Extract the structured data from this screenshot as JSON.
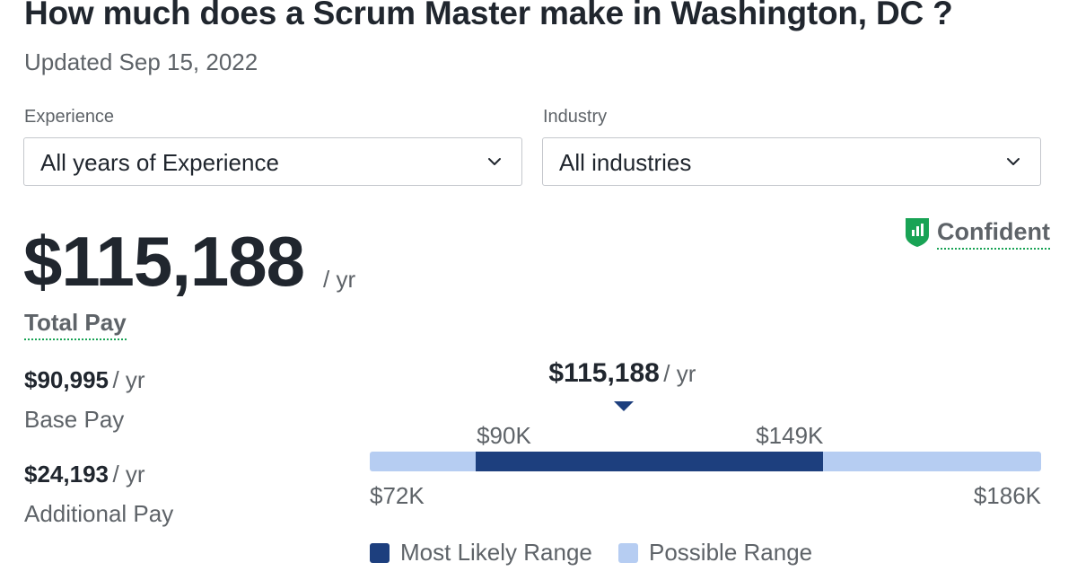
{
  "header": {
    "title": "How much does a Scrum Master make in Washington, DC ?",
    "updated": "Updated Sep 15, 2022"
  },
  "filters": {
    "experience": {
      "label": "Experience",
      "value": "All years of Experience"
    },
    "industry": {
      "label": "Industry",
      "value": "All industries"
    }
  },
  "salary": {
    "total_amount": "$115,188",
    "per_year": "/ yr",
    "total_label": "Total Pay",
    "confidence": "Confident",
    "base": {
      "amount": "$90,995",
      "per_year": "/ yr",
      "label": "Base Pay"
    },
    "additional": {
      "amount": "$24,193",
      "per_year": "/ yr",
      "label": "Additional Pay"
    }
  },
  "range_chart": {
    "median_label": "$115,188",
    "median_per_year": "/ yr",
    "min_label": "$72K",
    "max_label": "$186K",
    "likely_low_label": "$90K",
    "likely_high_label": "$149K",
    "min": 72,
    "max": 186,
    "likely_low": 90,
    "likely_high": 149,
    "median": 115.188,
    "legend": {
      "likely": "Most Likely Range",
      "possible": "Possible Range"
    },
    "colors": {
      "likely": "#1d3f7e",
      "possible": "#b6cdf2",
      "confidence_badge": "#19a355"
    }
  }
}
